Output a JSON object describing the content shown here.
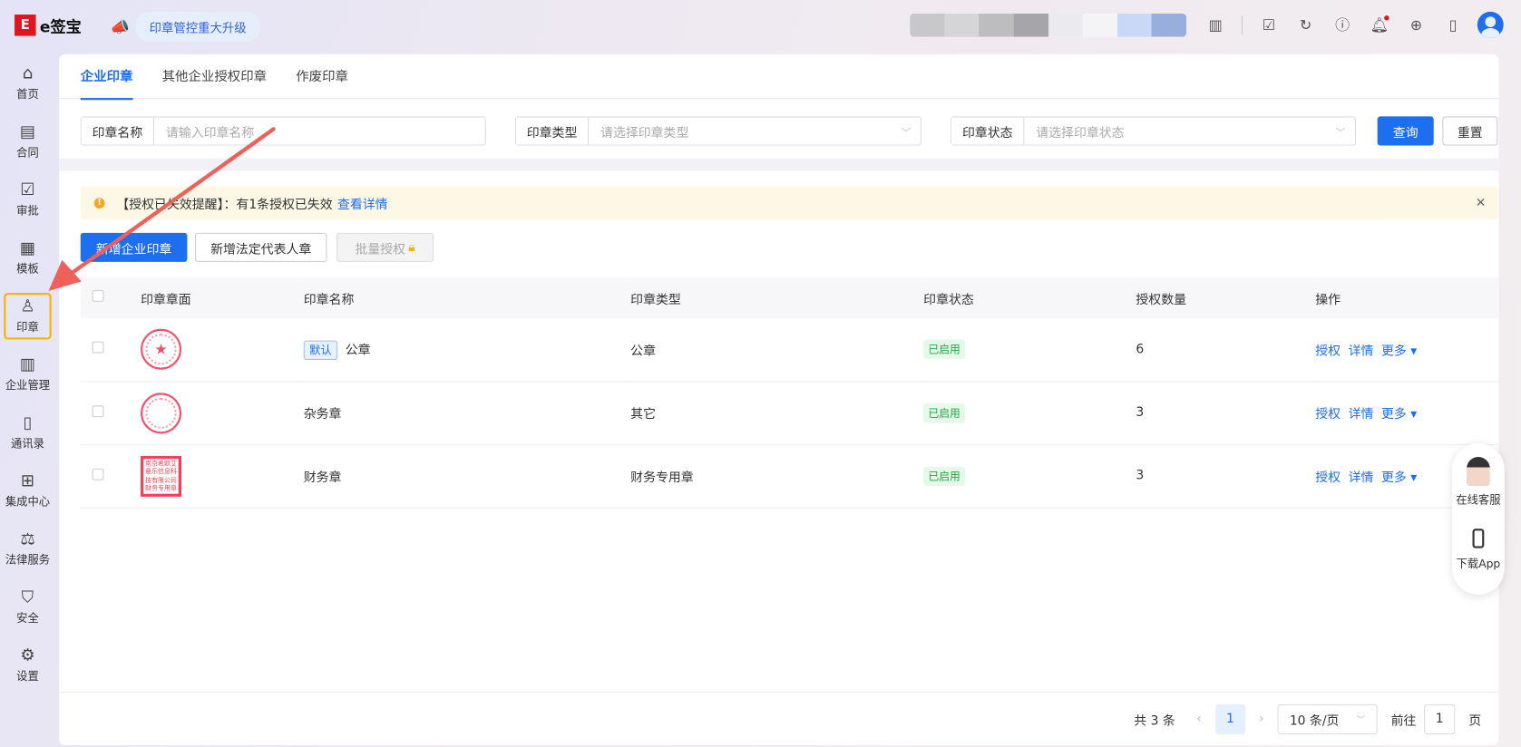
{
  "topbar": {
    "brand_logo": "E",
    "brand_name": "e签宝",
    "promo": "印章管控重大升级",
    "icons": [
      "building-icon",
      "todo-check-icon",
      "history-icon",
      "help-icon",
      "bell-icon",
      "globe-icon",
      "device-icon"
    ],
    "mosaic_colors": [
      "#c8c8cb",
      "#d5d5d8",
      "#bdbdc0",
      "#a6a6aa",
      "#ebebef",
      "#f4f3f6",
      "#c9d8f6",
      "#98aedc"
    ]
  },
  "sidebar": {
    "items": [
      {
        "label": "首页",
        "icon": "home-icon",
        "glyph": "⌂"
      },
      {
        "label": "合同",
        "icon": "contract-icon",
        "glyph": "▤"
      },
      {
        "label": "审批",
        "icon": "approval-icon",
        "glyph": "☑"
      },
      {
        "label": "模板",
        "icon": "template-icon",
        "glyph": "▦"
      },
      {
        "label": "印章",
        "icon": "seal-icon",
        "glyph": "♙",
        "active": true
      },
      {
        "label": "企业管理",
        "icon": "enterprise-icon",
        "glyph": "▥"
      },
      {
        "label": "通讯录",
        "icon": "contacts-icon",
        "glyph": "▯"
      },
      {
        "label": "集成中心",
        "icon": "integration-icon",
        "glyph": "⊞"
      },
      {
        "label": "法律服务",
        "icon": "legal-icon",
        "glyph": "⚖"
      },
      {
        "label": "安全",
        "icon": "shield-icon",
        "glyph": "⛉"
      },
      {
        "label": "设置",
        "icon": "gear-icon",
        "glyph": "⚙"
      }
    ]
  },
  "tabs": [
    "企业印章",
    "其他企业授权印章",
    "作废印章"
  ],
  "filters": {
    "name_label": "印章名称",
    "name_placeholder": "请输入印章名称",
    "type_label": "印章类型",
    "type_placeholder": "请选择印章类型",
    "status_label": "印章状态",
    "status_placeholder": "请选择印章状态",
    "query": "查询",
    "reset": "重置"
  },
  "alert": {
    "text": "【授权已失效提醒】：有1条授权已失效",
    "link": "查看详情"
  },
  "actions": {
    "add_enterprise": "新增企业印章",
    "add_legal": "新增法定代表人章",
    "batch_auth": "批量授权"
  },
  "table": {
    "headers": [
      "印章章面",
      "印章名称",
      "印章类型",
      "印章状态",
      "授权数量",
      "操作"
    ],
    "rows": [
      {
        "default_tag": "默认",
        "name": "公章",
        "type": "公章",
        "status": "已启用",
        "count": "6",
        "seal": "round-star"
      },
      {
        "default_tag": "",
        "name": "杂务章",
        "type": "其它",
        "status": "已启用",
        "count": "3",
        "seal": "round"
      },
      {
        "default_tag": "",
        "name": "财务章",
        "type": "财务专用章",
        "status": "已启用",
        "count": "3",
        "seal": "square",
        "seal_text": "南京希默艾悬乐信息科技有限公司财务专用章"
      }
    ],
    "ops": [
      "授权",
      "详情",
      "更多 ▾"
    ]
  },
  "pagination": {
    "total": "共 3 条",
    "current": "1",
    "page_size": "10 条/页",
    "goto_label": "前往",
    "goto_value": "1",
    "page_unit": "页"
  },
  "float_panel": {
    "service": "在线客服",
    "download": "下载App"
  },
  "colors": {
    "accent": "#1e6ef0",
    "brand": "#e0161e",
    "annotation_arrow": "#f0605a",
    "active_highlight": "#f5b400"
  }
}
